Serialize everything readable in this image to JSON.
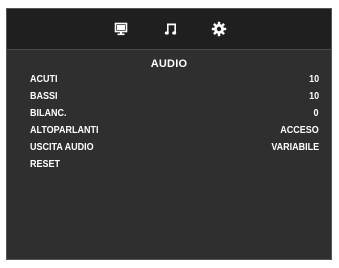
{
  "tabs": [
    {
      "icon": "monitor-icon"
    },
    {
      "icon": "music-note-icon"
    },
    {
      "icon": "gear-icon"
    }
  ],
  "menu": {
    "title": "AUDIO",
    "items": [
      {
        "label": "ACUTI",
        "value": "10"
      },
      {
        "label": "BASSI",
        "value": "10"
      },
      {
        "label": "BILANC.",
        "value": "0"
      },
      {
        "label": "ALTOPARLANTI",
        "value": "ACCESO"
      },
      {
        "label": "USCITA AUDIO",
        "value": "VARIABILE"
      },
      {
        "label": "RESET",
        "value": ""
      }
    ]
  },
  "colors": {
    "background": "#2f2f2f",
    "icon_bar": "#1f1f1f",
    "text": "#ffffff"
  }
}
